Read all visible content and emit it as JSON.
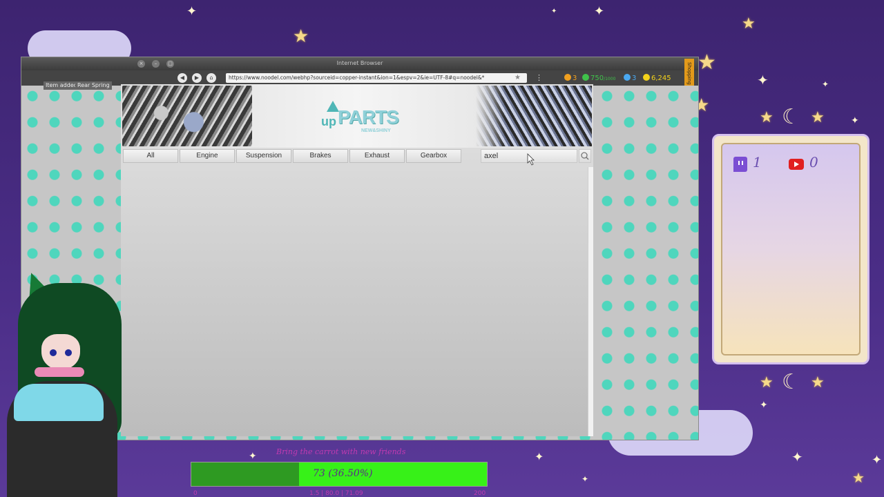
{
  "browser": {
    "window_title": "Internet Browser",
    "url": "https://www.noodel.com/webhp?sourceid=copper-instant&ion=1&espv=2&ie=UTF-8#q=noodel&*",
    "stats": {
      "level": "3",
      "xp": "750",
      "xp_unit": "/1000",
      "time": "3",
      "money": "6,245"
    },
    "notice_left": "Item added",
    "notice_right": "Rear Spring",
    "shopping_list_label": "Shopping list"
  },
  "site": {
    "logo_up": "up",
    "logo_parts": "PARTS",
    "logo_sub": "NEW&SHINY",
    "categories": [
      "All",
      "Engine",
      "Suspension",
      "Brakes",
      "Exhaust",
      "Gearbox"
    ],
    "search_value": "axel"
  },
  "panel": {
    "twitch_count": "1",
    "youtube_count": "0"
  },
  "goal": {
    "title": "Bring the carrot with new friends",
    "label": "73 (36.50%)",
    "progress_fraction": 0.365,
    "foot_left": "0",
    "foot_mid": "1.5 | 80.0 | 71.09",
    "foot_right": "200"
  },
  "colors": {
    "goal_fill": "#37f118",
    "goal_fill_dark": "#2e9a22",
    "panel_bg": "#f3e6c9",
    "accent_teal": "#4fd6bd"
  }
}
